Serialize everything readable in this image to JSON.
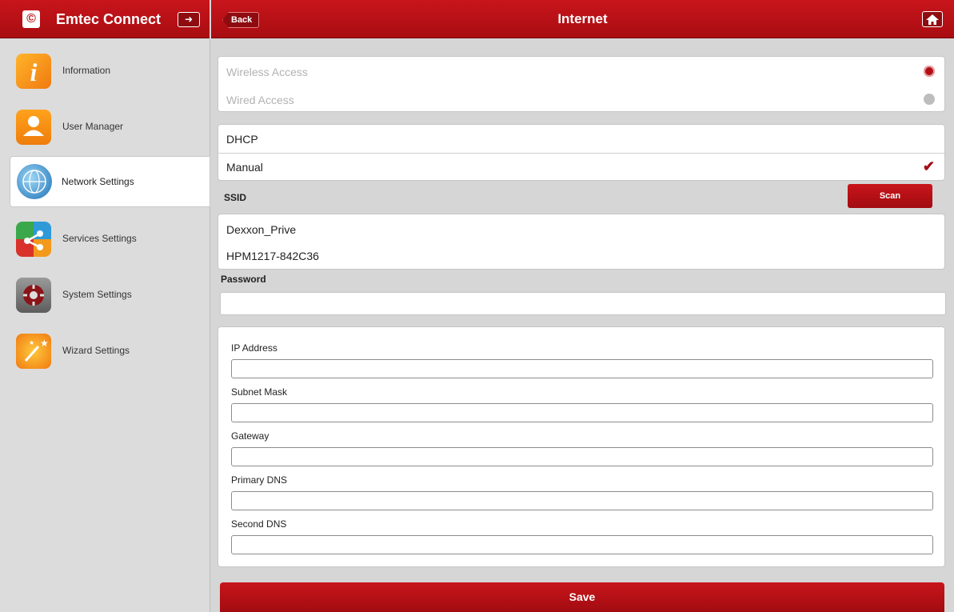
{
  "header": {
    "brand_logo": "©",
    "brand_name": "Emtec Connect",
    "logout_icon": "logout-icon",
    "back_label": "Back",
    "title": "Internet",
    "home_icon": "home-icon",
    "accent": "#b20f14"
  },
  "sidebar": {
    "items": [
      {
        "label": "Information",
        "icon": "info-icon"
      },
      {
        "label": "User Manager",
        "icon": "user-icon"
      },
      {
        "label": "Network Settings",
        "icon": "globe-icon",
        "active": true
      },
      {
        "label": "Services Settings",
        "icon": "share-icon"
      },
      {
        "label": "System Settings",
        "icon": "gear-icon"
      },
      {
        "label": "Wizard Settings",
        "icon": "wand-icon"
      }
    ]
  },
  "access": {
    "wireless_label": "Wireless Access",
    "wired_label": "Wired Access",
    "selected": "Wireless Access"
  },
  "mode": {
    "dhcp_label": "DHCP",
    "manual_label": "Manual",
    "selected": "Manual"
  },
  "ssid": {
    "label": "SSID",
    "scan_label": "Scan",
    "networks": [
      "Dexxon_Prive",
      "HPM1217-842C36"
    ]
  },
  "password": {
    "label": "Password",
    "value": ""
  },
  "ip": {
    "fields": [
      {
        "label": "IP Address",
        "value": ""
      },
      {
        "label": "Subnet Mask",
        "value": ""
      },
      {
        "label": "Gateway",
        "value": ""
      },
      {
        "label": "Primary DNS",
        "value": ""
      },
      {
        "label": "Second DNS",
        "value": ""
      }
    ]
  },
  "save_label": "Save"
}
